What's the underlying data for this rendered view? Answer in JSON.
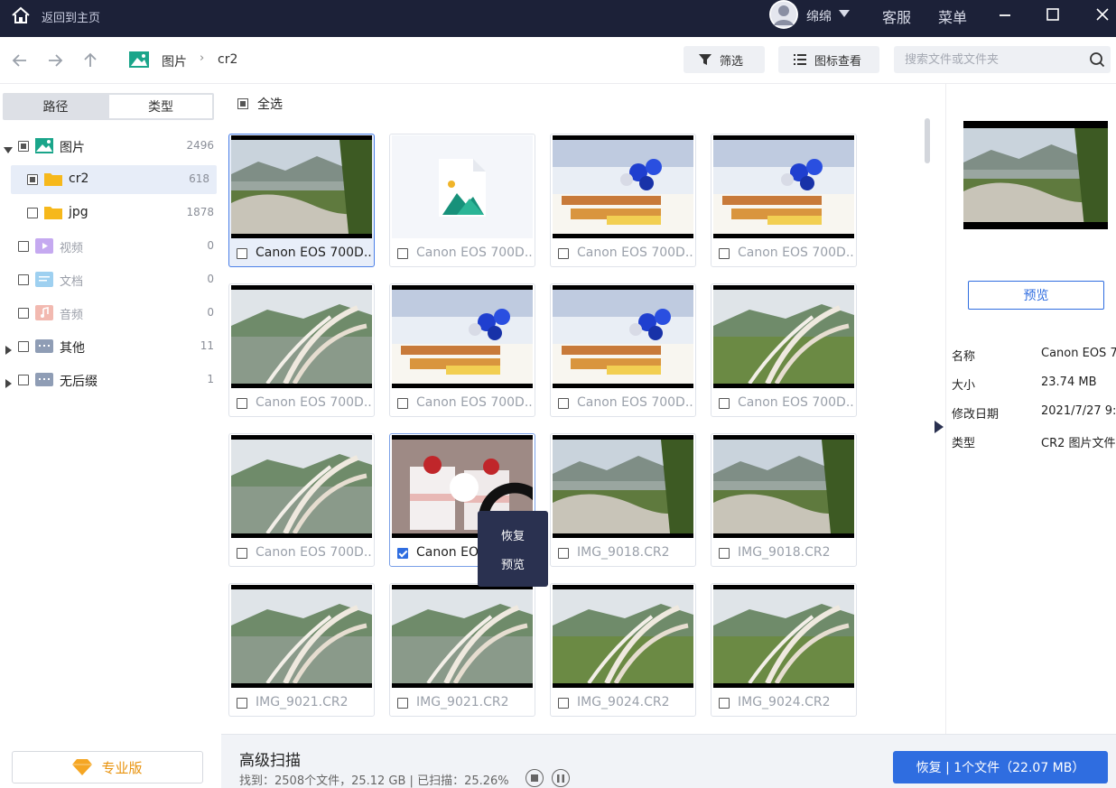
{
  "titlebar": {
    "back_home": "返回到主页",
    "username": "绵绵",
    "support": "客服",
    "menu": "菜单"
  },
  "toolbar": {
    "breadcrumb": [
      "图片",
      "cr2"
    ],
    "filter_label": "筛选",
    "view_label": "图标查看",
    "search_placeholder": "搜索文件或文件夹"
  },
  "sidebar": {
    "tabs": [
      "路径",
      "类型"
    ],
    "active_tab": "类型",
    "tree": [
      {
        "label": "图片",
        "count": "2496",
        "icon": "image-folder-icon",
        "expanded": true
      },
      {
        "label": "cr2",
        "count": "618",
        "icon": "folder-icon",
        "selected": true
      },
      {
        "label": "jpg",
        "count": "1878",
        "icon": "folder-icon"
      },
      {
        "label": "视频",
        "count": "0",
        "icon": "video-icon"
      },
      {
        "label": "文档",
        "count": "0",
        "icon": "document-icon"
      },
      {
        "label": "音频",
        "count": "0",
        "icon": "audio-icon"
      },
      {
        "label": "其他",
        "count": "11",
        "icon": "other-folder-icon"
      },
      {
        "label": "无后缀",
        "count": "1",
        "icon": "other-folder-icon"
      }
    ],
    "pro_label": "专业版"
  },
  "main": {
    "select_all": "全选",
    "files": [
      {
        "name": "Canon EOS 700D...",
        "thumb": "river"
      },
      {
        "name": "Canon EOS 700D...",
        "thumb": "doc"
      },
      {
        "name": "Canon EOS 700D...",
        "thumb": "party"
      },
      {
        "name": "Canon EOS 700D...",
        "thumb": "party"
      },
      {
        "name": "Canon EOS 700D...",
        "thumb": "reeds"
      },
      {
        "name": "Canon EOS 700D...",
        "thumb": "party2"
      },
      {
        "name": "Canon EOS 700D...",
        "thumb": "party2"
      },
      {
        "name": "Canon EOS 700D...",
        "thumb": "reeds2"
      },
      {
        "name": "Canon EOS 700D...",
        "thumb": "reeds"
      },
      {
        "name": "Canon EOS 700D...",
        "thumb": "dessert"
      },
      {
        "name": "IMG_9018.CR2",
        "thumb": "river"
      },
      {
        "name": "IMG_9018.CR2",
        "thumb": "river"
      },
      {
        "name": "IMG_9021.CR2",
        "thumb": "reeds"
      },
      {
        "name": "IMG_9021.CR2",
        "thumb": "reeds"
      },
      {
        "name": "IMG_9024.CR2",
        "thumb": "reeds2"
      },
      {
        "name": "IMG_9024.CR2",
        "thumb": "reeds2"
      }
    ],
    "context_menu": [
      "恢复",
      "预览"
    ]
  },
  "details": {
    "preview_label": "预览",
    "rows": [
      {
        "key": "名称",
        "value": "Canon EOS 7..."
      },
      {
        "key": "大小",
        "value": "23.74 MB"
      },
      {
        "key": "修改日期",
        "value": "2021/7/27 9:"
      },
      {
        "key": "类型",
        "value": "CR2 图片文件"
      }
    ]
  },
  "bottom": {
    "scan_title": "高级扫描",
    "scan_stats": "找到：2508个文件，25.12 GB | 已扫描：25.26%",
    "recover_label": "恢复 | 1个文件（22.07 MB）"
  },
  "colors": {
    "accent": "#2f6de0",
    "titlebar": "#1c2138",
    "pro": "#e8930e"
  }
}
